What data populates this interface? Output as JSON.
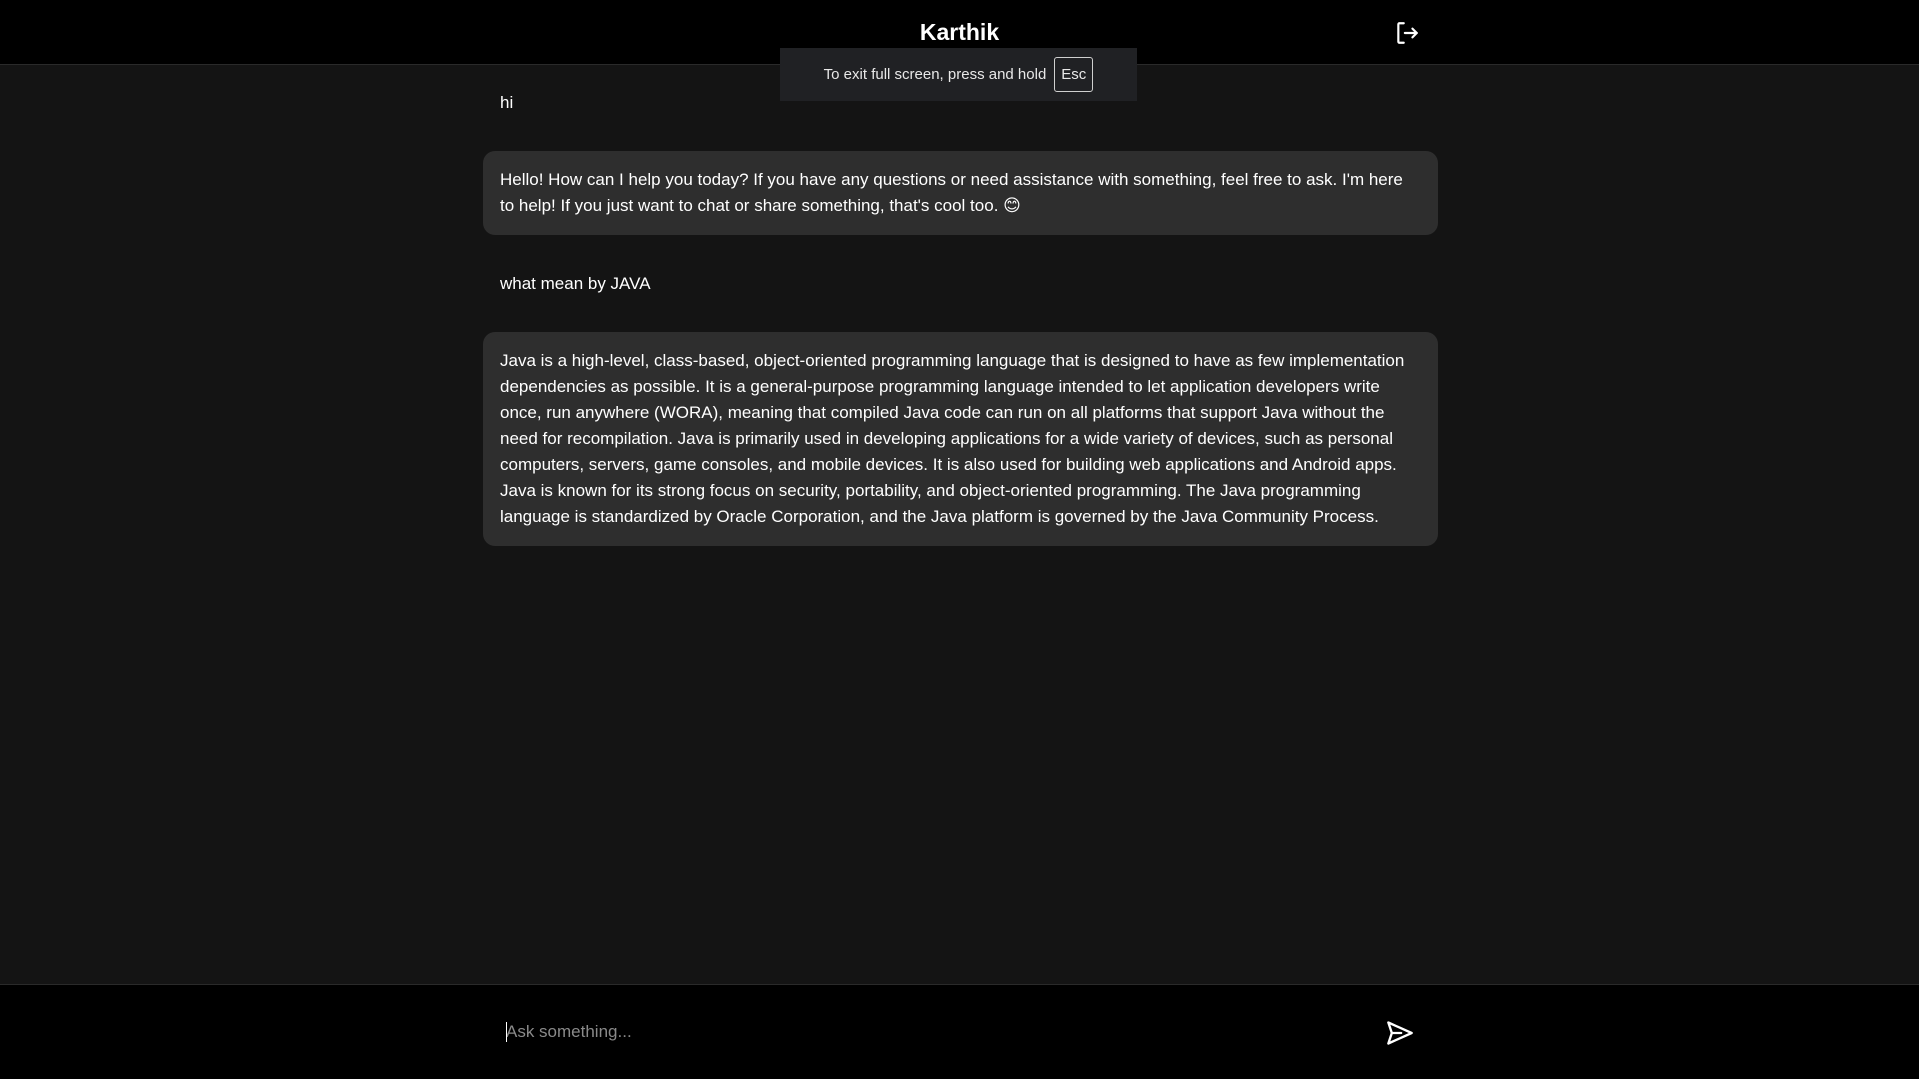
{
  "header": {
    "title": "Karthik",
    "logout_icon": "logout-icon"
  },
  "fullscreen_notice": {
    "text": "To exit full screen, press and hold",
    "key": "Esc"
  },
  "messages": [
    {
      "role": "user",
      "text": "hi"
    },
    {
      "role": "assistant",
      "text": "Hello! How can I help you today? If you have any questions or need assistance with something, feel free to ask. I'm here to help! If you just want to chat or share something, that's cool too. 😊"
    },
    {
      "role": "user",
      "text": "what mean by JAVA"
    },
    {
      "role": "assistant",
      "text": "Java is a high-level, class-based, object-oriented programming language that is designed to have as few implementation dependencies as possible. It is a general-purpose programming language intended to let application developers write once, run anywhere (WORA), meaning that compiled Java code can run on all platforms that support Java without the need for recompilation. Java is primarily used in developing applications for a wide variety of devices, such as personal computers, servers, game consoles, and mobile devices. It is also used for building web applications and Android apps. Java is known for its strong focus on security, portability, and object-oriented programming. The Java programming language is standardized by Oracle Corporation, and the Java platform is governed by the Java Community Process."
    }
  ],
  "composer": {
    "placeholder": "Ask something...",
    "value": "",
    "send_icon": "send-icon"
  },
  "colors": {
    "background": "#141414",
    "bar": "#000000",
    "bubble": "#2e2e2e",
    "text": "#ffffff",
    "placeholder": "#8a8a8a"
  }
}
